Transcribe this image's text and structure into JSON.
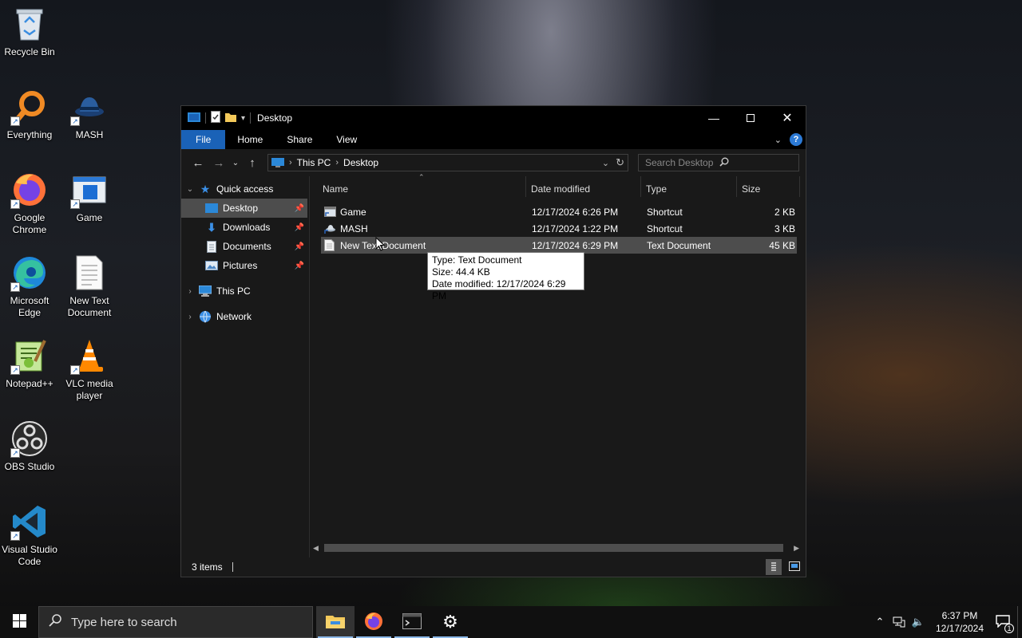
{
  "desktop": {
    "icons": [
      {
        "label": "Recycle Bin",
        "icon": "recycle-bin-icon"
      },
      {
        "label": "Everything",
        "icon": "everything-search-icon"
      },
      {
        "label": "MASH",
        "icon": "mash-hat-icon"
      },
      {
        "label": "Google Chrome",
        "icon": "firefox-icon"
      },
      {
        "label": "Game",
        "icon": "game-window-icon"
      },
      {
        "label": "Microsoft Edge",
        "icon": "edge-icon"
      },
      {
        "label": "New Text Document",
        "icon": "text-document-icon"
      },
      {
        "label": "Notepad++",
        "icon": "notepadpp-icon"
      },
      {
        "label": "VLC media player",
        "icon": "vlc-cone-icon"
      },
      {
        "label": "OBS Studio",
        "icon": "obs-icon"
      },
      {
        "label": "Visual Studio Code",
        "icon": "vscode-icon"
      }
    ]
  },
  "explorer": {
    "title": "Desktop",
    "ribbon_tabs": {
      "file": "File",
      "home": "Home",
      "share": "Share",
      "view": "View"
    },
    "address": {
      "segment1": "This PC",
      "segment2": "Desktop"
    },
    "search": {
      "placeholder": "Search Desktop"
    },
    "nav": {
      "quick_access": "Quick access",
      "desktop": "Desktop",
      "downloads": "Downloads",
      "documents": "Documents",
      "pictures": "Pictures",
      "this_pc": "This PC",
      "network": "Network"
    },
    "columns": {
      "name": "Name",
      "date": "Date modified",
      "type": "Type",
      "size": "Size"
    },
    "files": [
      {
        "name": "Game",
        "date": "12/17/2024 6:26 PM",
        "type": "Shortcut",
        "size": "2 KB"
      },
      {
        "name": "MASH",
        "date": "12/17/2024 1:22 PM",
        "type": "Shortcut",
        "size": "3 KB"
      },
      {
        "name": "New Text Document",
        "date": "12/17/2024 6:29 PM",
        "type": "Text Document",
        "size": "45 KB"
      }
    ],
    "tooltip": {
      "line1": "Type: Text Document",
      "line2": "Size: 44.4 KB",
      "line3": "Date modified: 12/17/2024 6:29 PM"
    },
    "status": {
      "items": "3 items"
    }
  },
  "taskbar": {
    "search_placeholder": "Type here to search",
    "time": "6:37 PM",
    "date": "12/17/2024",
    "notification_count": "1"
  },
  "colors": {
    "accent": "#1a62b7",
    "selection": "#4d4d4d",
    "window_bg": "#191919"
  }
}
